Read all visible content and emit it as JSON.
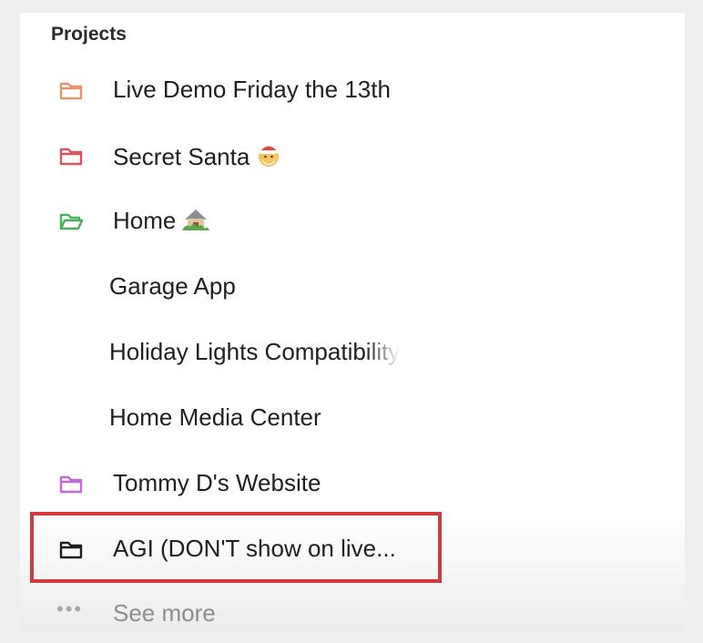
{
  "sidebar": {
    "section_title": "Projects",
    "items": [
      {
        "label": "Live Demo Friday the 13th",
        "icon": "folder-icon",
        "color": "#e6956b"
      },
      {
        "label": "Secret Santa",
        "icon": "folder-icon",
        "color": "#d9535f",
        "emoji": "santa-emoji"
      },
      {
        "label": "Home",
        "icon": "folder-open-icon",
        "color": "#49b05a",
        "emoji": "house-emoji"
      },
      {
        "label": "Garage App"
      },
      {
        "label": "Holiday Lights Compatibility"
      },
      {
        "label": "Home Media Center"
      },
      {
        "label": "Tommy D's Website",
        "icon": "folder-icon",
        "color": "#c369d6"
      },
      {
        "label": "AGI (DON'T show on live...",
        "icon": "folder-icon",
        "color": "#1f1f1f"
      }
    ],
    "see_more": {
      "label": "See more",
      "icon": "more-dots-icon"
    }
  },
  "annotation": {
    "color": "#d33a3f"
  }
}
